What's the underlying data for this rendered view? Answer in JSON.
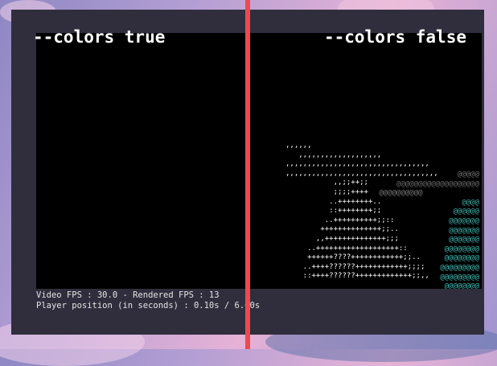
{
  "labels": {
    "left": "--colors true",
    "right": "--colors false"
  },
  "status": {
    "fps_line": "Video FPS : 30.0 - Rendered FPS : 13",
    "position_line": "Player position (in seconds) : 0.10s / 6.00s"
  },
  "ascii_color_rows": [
    {
      "text": "@@@@@",
      "color": "#6f6f6f"
    },
    {
      "text": "@@@@@@@@@@@@@@@@@@@",
      "color": "#6b6b6b"
    },
    {
      "text": "@@@@@@@@@@             ",
      "color": "#7a7a7a"
    },
    {
      "text": "@@@@",
      "color": "#3fa9a4"
    },
    {
      "text": "@@@@@@",
      "color": "#42b0ab"
    },
    {
      "text": "@@@@@@@",
      "color": "#3fb2ad"
    },
    {
      "text": "@@@@@@@",
      "color": "#3cb4ae"
    },
    {
      "text": "@@@@@@@",
      "color": "#40b6b0"
    },
    {
      "text": "@@@@@@@@",
      "color": "#3fb8b2"
    },
    {
      "text": "@@@@@@@@",
      "color": "#3cbab3"
    },
    {
      "text": "@@@@@@@@@",
      "color": "#40bcb5"
    },
    {
      "text": "@@@@@@@@@",
      "color": "#3ebdb6"
    },
    {
      "text": "@@@@@@@@",
      "color": "#3dbfb7"
    },
    {
      "text": "@@@@@@@@",
      "color": "#41c1b9"
    },
    {
      "text": "@@@@@@@@",
      "color": "#3fc3bb"
    }
  ],
  "ascii_mono": ",,,,,,\n   ,,,,,,,,,,,,,,,,,,,\n,,,,,,,,,,,,,,,,,,,,,,,,,,,,,,,,,\n,,,,,,,,,,,,,,,,,,,,,,,,,,,,,,,,,,,\n           ,,;;++;;\n           ;;;;++++\n          ..++++++++..\n          ::++++++++;;\n         ..++++++++++;;::\n        ++++++++++++++;;..\n       ,,++++++++++++++;;;\n     ..+++++++++++++++++++::\n     ++++++????++++++++++++;;..\n    ..++++??????++++++++++++;;;;\n    ::++++??????+++++++++++++;;,,"
}
